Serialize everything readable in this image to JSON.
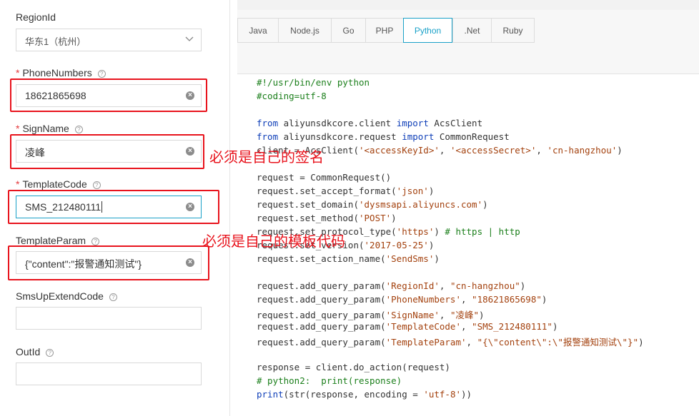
{
  "form": {
    "region": {
      "label": "RegionId",
      "value": "华东1（杭州）"
    },
    "phone": {
      "label": "PhoneNumbers",
      "value": "18621865698"
    },
    "sign": {
      "label": "SignName",
      "value": "凌峰"
    },
    "template_code": {
      "label": "TemplateCode",
      "value": "SMS_212480111"
    },
    "template_param": {
      "label": "TemplateParam",
      "value": "{\"content\":\"报警通知测试\"}"
    },
    "sms_up": {
      "label": "SmsUpExtendCode",
      "value": ""
    },
    "out_id": {
      "label": "OutId",
      "value": ""
    }
  },
  "annotations": {
    "note1": "必须是自己的签名",
    "note2": "必须是自己的模板代码"
  },
  "tabs": [
    "Java",
    "Node.js",
    "Go",
    "PHP",
    "Python",
    ".Net",
    "Ruby"
  ],
  "active_tab": "Python",
  "colors": {
    "accent": "#1aa1c8",
    "annotation_red": "#e8131c",
    "keyword": "#0f3fb8",
    "string": "#a3410e",
    "comment": "#1b7f1b"
  },
  "code": {
    "l1": "#!/usr/bin/env python",
    "l2": "#coding=utf-8",
    "l3": "from aliyunsdkcore.client import AcsClient",
    "l4": "from aliyunsdkcore.request import CommonRequest",
    "l5": "client = AcsClient('<accessKeyId>', '<accessSecret>', 'cn-hangzhou')",
    "l6": "request = CommonRequest()",
    "l7": "request.set_accept_format('json')",
    "l8": "request.set_domain('dysmsapi.aliyuncs.com')",
    "l9": "request.set_method('POST')",
    "l10": "request.set_protocol_type('https') # https | http",
    "l11": "request.set_version('2017-05-25')",
    "l12": "request.set_action_name('SendSms')",
    "l13": "request.add_query_param('RegionId', \"cn-hangzhou\")",
    "l14": "request.add_query_param('PhoneNumbers', \"18621865698\")",
    "l15": "request.add_query_param('SignName', \"凌峰\")",
    "l16": "request.add_query_param('TemplateCode', \"SMS_212480111\")",
    "l17": "request.add_query_param('TemplateParam', \"{\\\"content\\\":\\\"报警通知测试\\\"}\")",
    "l18": "response = client.do_action(request)",
    "l19": "# python2:  print(response)",
    "l20": "print(str(response, encoding = 'utf-8'))"
  }
}
